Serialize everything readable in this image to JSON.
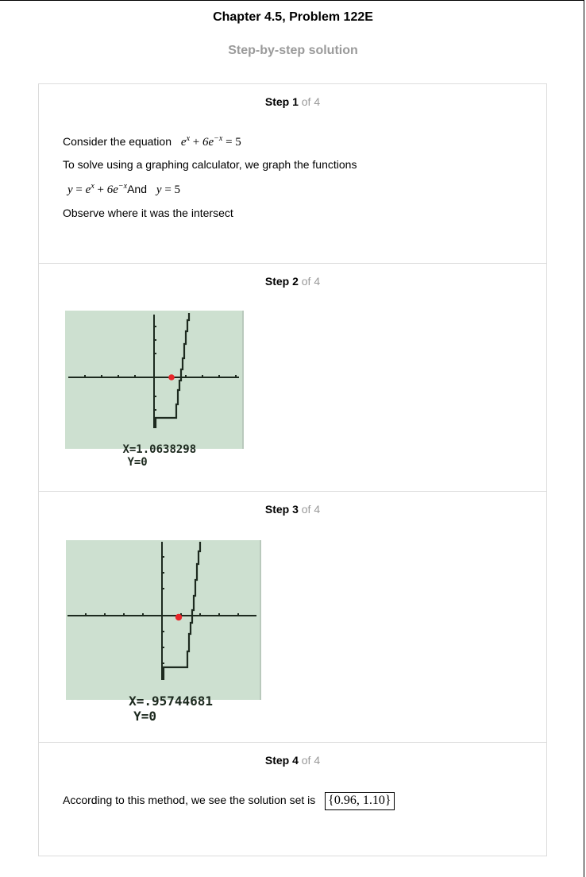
{
  "header": {
    "title": "Chapter 4.5, Problem 122E",
    "subtitle": "Step-by-step solution"
  },
  "steps": [
    {
      "label": "Step 1",
      "of": "of 4",
      "lines": {
        "consider": "Consider the equation",
        "solve": "To solve using a graphing calculator, we graph the functions",
        "and": "And",
        "observe": "Observe where it was the intersect"
      }
    },
    {
      "label": "Step 2",
      "of": "of 4",
      "calculator": {
        "readout_x": "X=1.0638298",
        "readout_y": "Y=0",
        "intersection_x": 1.0638298,
        "intersection_y": 0
      }
    },
    {
      "label": "Step 3",
      "of": "of 4",
      "calculator": {
        "readout_x": "X=.95744681",
        "readout_y": "Y=0",
        "intersection_x": 0.95744681,
        "intersection_y": 0
      }
    },
    {
      "label": "Step 4",
      "of": "of 4",
      "conclusion": "According to this method, we see the solution set is",
      "solution_set": "{0.96, 1.10}"
    }
  ],
  "colors": {
    "calculator_screen": "#cde0d0",
    "intersection_point": "#e8262a",
    "muted_text": "#9a9a9a"
  }
}
